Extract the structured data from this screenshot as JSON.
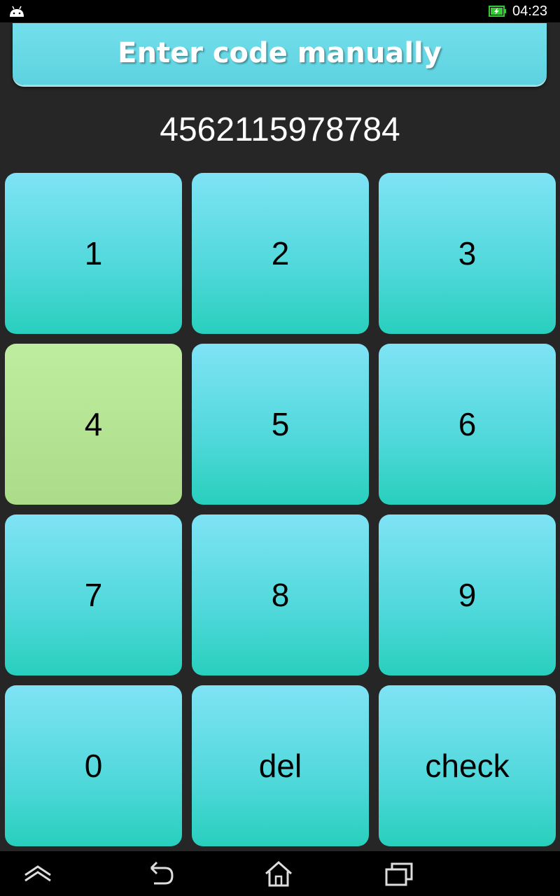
{
  "status_bar": {
    "time": "04:23",
    "icons": [
      "android-icon",
      "battery-charging-icon"
    ],
    "battery_color": "#33cc33"
  },
  "header": {
    "title": "Enter code manually"
  },
  "code": {
    "value": "4562115978784"
  },
  "keypad": {
    "keys": [
      "1",
      "2",
      "3",
      "4",
      "5",
      "6",
      "7",
      "8",
      "9",
      "0",
      "del",
      "check"
    ],
    "pressed_key": "4"
  },
  "nav_bar": {
    "icons": [
      "up-chevron-icon",
      "back-icon",
      "home-icon",
      "recent-apps-icon"
    ]
  },
  "colors": {
    "key_top": "#7fe3f5",
    "key_bottom": "#28cfbd",
    "key_pressed": "#bfed9f",
    "header": "#6ad9e6",
    "background": "#262626"
  }
}
